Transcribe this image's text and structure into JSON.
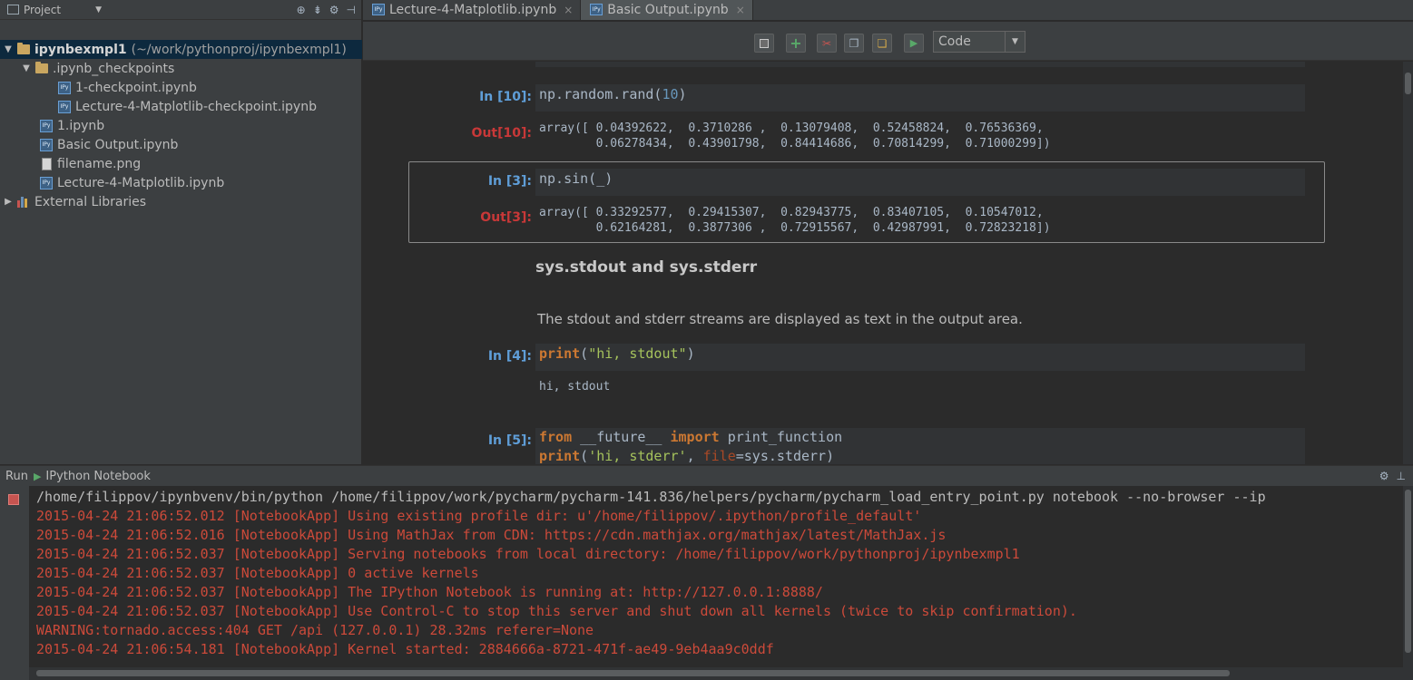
{
  "project_panel": {
    "header_label": "Project",
    "tree": [
      {
        "label": "ipynbexmpl1",
        "suffix": "(~/work/pythonproj/ipynbexmpl1)",
        "kind": "folder",
        "level": 0,
        "expanded": true,
        "selected": true,
        "bold": true
      },
      {
        "label": ".ipynb_checkpoints",
        "kind": "folder",
        "level": 1,
        "expanded": true
      },
      {
        "label": "1-checkpoint.ipynb",
        "kind": "notebook",
        "level": 2
      },
      {
        "label": "Lecture-4-Matplotlib-checkpoint.ipynb",
        "kind": "notebook",
        "level": 2
      },
      {
        "label": "1.ipynb",
        "kind": "notebook",
        "level": 1
      },
      {
        "label": "Basic Output.ipynb",
        "kind": "notebook",
        "level": 1
      },
      {
        "label": "filename.png",
        "kind": "image",
        "level": 1
      },
      {
        "label": "Lecture-4-Matplotlib.ipynb",
        "kind": "notebook",
        "level": 1
      },
      {
        "label": "External Libraries",
        "kind": "libraries",
        "level": 0,
        "expanded": false
      }
    ]
  },
  "tabs": [
    {
      "label": "Lecture-4-Matplotlib.ipynb",
      "active": false
    },
    {
      "label": "Basic Output.ipynb",
      "active": true
    }
  ],
  "toolbar": {
    "icons": [
      "save-icon",
      "add-cell-icon",
      "cut-icon",
      "copy-icon",
      "paste-icon",
      "run-icon"
    ],
    "cell_type": "Code"
  },
  "notebook": {
    "cell10": {
      "in_prompt": "In [10]:",
      "code": "np.random.rand(10)",
      "out_prompt": "Out[10]:",
      "output": "array([ 0.04392622,  0.3710286 ,  0.13079408,  0.52458824,  0.76536369,\n        0.06278434,  0.43901798,  0.84414686,  0.70814299,  0.71000299])"
    },
    "cell3": {
      "in_prompt": "In [3]:",
      "code": "np.sin(_)",
      "out_prompt": "Out[3]:",
      "output": "array([ 0.33292577,  0.29415307,  0.82943775,  0.83407105,  0.10547012,\n        0.62164281,  0.3877306 ,  0.72915567,  0.42987991,  0.72823218])"
    },
    "markdown": {
      "heading": "sys.stdout and sys.stderr",
      "text": "The stdout and stderr streams are displayed as text in the output area."
    },
    "cell4": {
      "in_prompt": "In [4]:",
      "code": "print(\"hi, stdout\")",
      "output": "hi, stdout"
    },
    "cell5": {
      "in_prompt": "In [5]:",
      "code_line1": "from __future__ import print_function",
      "code_line2": "print('hi, stderr', file=sys.stderr)"
    }
  },
  "run_panel": {
    "run_label": "Run",
    "config_name": "IPython Notebook",
    "lines": [
      "/home/filippov/ipynbvenv/bin/python /home/filippov/work/pycharm/pycharm-141.836/helpers/pycharm/pycharm_load_entry_point.py notebook --no-browser --ip",
      "2015-04-24 21:06:52.012 [NotebookApp] Using existing profile dir: u'/home/filippov/.ipython/profile_default'",
      "2015-04-24 21:06:52.016 [NotebookApp] Using MathJax from CDN: https://cdn.mathjax.org/mathjax/latest/MathJax.js",
      "2015-04-24 21:06:52.037 [NotebookApp] Serving notebooks from local directory: /home/filippov/work/pythonproj/ipynbexmpl1",
      "2015-04-24 21:06:52.037 [NotebookApp] 0 active kernels",
      "2015-04-24 21:06:52.037 [NotebookApp] The IPython Notebook is running at: http://127.0.0.1:8888/",
      "2015-04-24 21:06:52.037 [NotebookApp] Use Control-C to stop this server and shut down all kernels (twice to skip confirmation).",
      "WARNING:tornado.access:404 GET /api (127.0.0.1) 28.32ms referer=None",
      "2015-04-24 21:06:54.181 [NotebookApp] Kernel started: 2884666a-8721-471f-ae49-9eb4aa9c0ddf"
    ]
  },
  "colors": {
    "prompt_in": "#5f9ed8",
    "prompt_out": "#c83838",
    "console_error": "#cc4a3a",
    "keyword": "#cc7832",
    "string": "#a5c25c"
  }
}
